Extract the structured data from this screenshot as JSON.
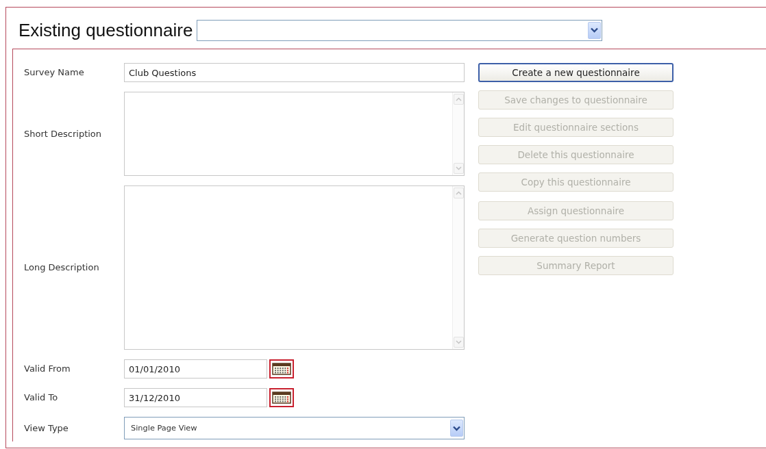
{
  "header": {
    "title": "Existing questionnaire",
    "questionnaire_select": {
      "kind": "select"
    }
  },
  "fields": [
    {
      "label": "Survey Name",
      "kind": "text",
      "value": "Club Questions"
    },
    {
      "label": "Short Description",
      "kind": "memo-short"
    },
    {
      "label": "Long Description",
      "kind": "memo-long"
    },
    {
      "label": "Valid From",
      "kind": "date",
      "value": "01/01/2010"
    },
    {
      "label": "Valid To",
      "kind": "date",
      "value": "31/12/2010"
    },
    {
      "label": "View Type",
      "kind": "select",
      "value": "Single Page View"
    }
  ],
  "buttons": [
    {
      "label": "Create a new questionnaire",
      "disabled": false
    },
    {
      "label": "Save changes to questionnaire",
      "disabled": true
    },
    {
      "label": "Edit questionnaire sections",
      "disabled": true
    },
    {
      "label": "Delete this questionnaire",
      "disabled": true
    },
    {
      "label": "Copy this questionnaire",
      "disabled": true
    },
    {
      "label": "Assign questionnaire",
      "disabled": true
    },
    {
      "label": "Generate question numbers",
      "disabled": true
    },
    {
      "label": "Summary Report",
      "disabled": true
    }
  ]
}
